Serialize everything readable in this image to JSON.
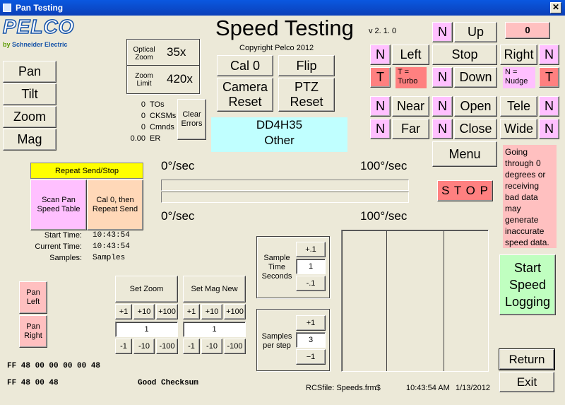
{
  "window": {
    "title": "Pan Testing"
  },
  "logo": {
    "brand": "PELCO",
    "sub_prefix": "by",
    "sub_brand": "Schneider Electric"
  },
  "header": {
    "title": "Speed Testing",
    "version": "v 2. 1. 0",
    "copyright": "Copyright Pelco 2012"
  },
  "left_buttons": [
    "Pan",
    "Tilt",
    "Zoom",
    "Mag"
  ],
  "zoom_info": {
    "optical_label": "Optical Zoom",
    "optical_value": "35x",
    "limit_label": "Zoom Limit",
    "limit_value": "420x"
  },
  "errors": {
    "rows": [
      {
        "value": "0",
        "label": "TOs"
      },
      {
        "value": "0",
        "label": "CKSMs"
      },
      {
        "value": "0",
        "label": "Cmnds"
      },
      {
        "value": "0.00",
        "label": "ER"
      }
    ],
    "clear_label": "Clear Errors"
  },
  "mid_buttons": {
    "cal0": "Cal 0",
    "flip": "Flip",
    "camera_reset": "Camera Reset",
    "ptz_reset": "PTZ Reset"
  },
  "device": {
    "model": "DD4H35",
    "type": "Other"
  },
  "ptz": {
    "counter": "0",
    "up": "Up",
    "left": "Left",
    "stop": "Stop",
    "right": "Right",
    "down": "Down",
    "near": "Near",
    "open": "Open",
    "tele": "Tele",
    "far": "Far",
    "close": "Close",
    "wide": "Wide",
    "menu": "Menu",
    "n": "N",
    "t": "T",
    "turbo": "T = Turbo",
    "nudge": "N = Nudge"
  },
  "warning": "Going through 0 degrees or receiving bad data may generate inaccurate speed data.",
  "stop_big": "S T O P",
  "speed_bar": {
    "min1": "0°/sec",
    "max1": "100°/sec",
    "min2": "0°/sec",
    "max2": "100°/sec"
  },
  "repeat": {
    "header": "Repeat Send/Stop",
    "scan": "Scan Pan Speed Table",
    "cal": "Cal 0, then Repeat Send"
  },
  "times": {
    "start_label": "Start Time:",
    "start_value": "10:43:54",
    "current_label": "Current Time:",
    "current_value": "10:43:54",
    "samples_label": "Samples:",
    "samples_value": "Samples"
  },
  "sample_time": {
    "label": "Sample Time Seconds",
    "up": "+.1",
    "value": "1",
    "down": "-.1"
  },
  "samples_step": {
    "label": "Samples per step",
    "up": "+1",
    "value": "3",
    "down": "−1"
  },
  "start_logging": "Start Speed Logging",
  "pan_left": "Pan Left",
  "pan_right": "Pan Right",
  "set_zoom": {
    "label": "Set Zoom",
    "p1": "+1",
    "p10": "+10",
    "p100": "+100",
    "value": "1",
    "m1": "-1",
    "m10": "-10",
    "m100": "-100"
  },
  "set_mag": {
    "label": "Set Mag New",
    "p1": "+1",
    "p10": "+10",
    "p100": "+100",
    "value": "1",
    "m1": "-1",
    "m10": "-10",
    "m100": "-100"
  },
  "hex1": "FF 48 00 00 00 00 48",
  "hex2": "FF 48 00 48",
  "checksum": "Good Checksum",
  "rcs": "RCSfile: Speeds.frm$",
  "clock_time": "10:43:54 AM",
  "clock_date": "1/13/2012",
  "return": "Return",
  "exit": "Exit",
  "colors": {
    "titlebar": "#0b4fd6",
    "pink": "#ffc0ff",
    "red": "#ff8080",
    "cyan": "#c0ffff",
    "yellow": "#ffff00",
    "green": "#c0ffc0"
  }
}
